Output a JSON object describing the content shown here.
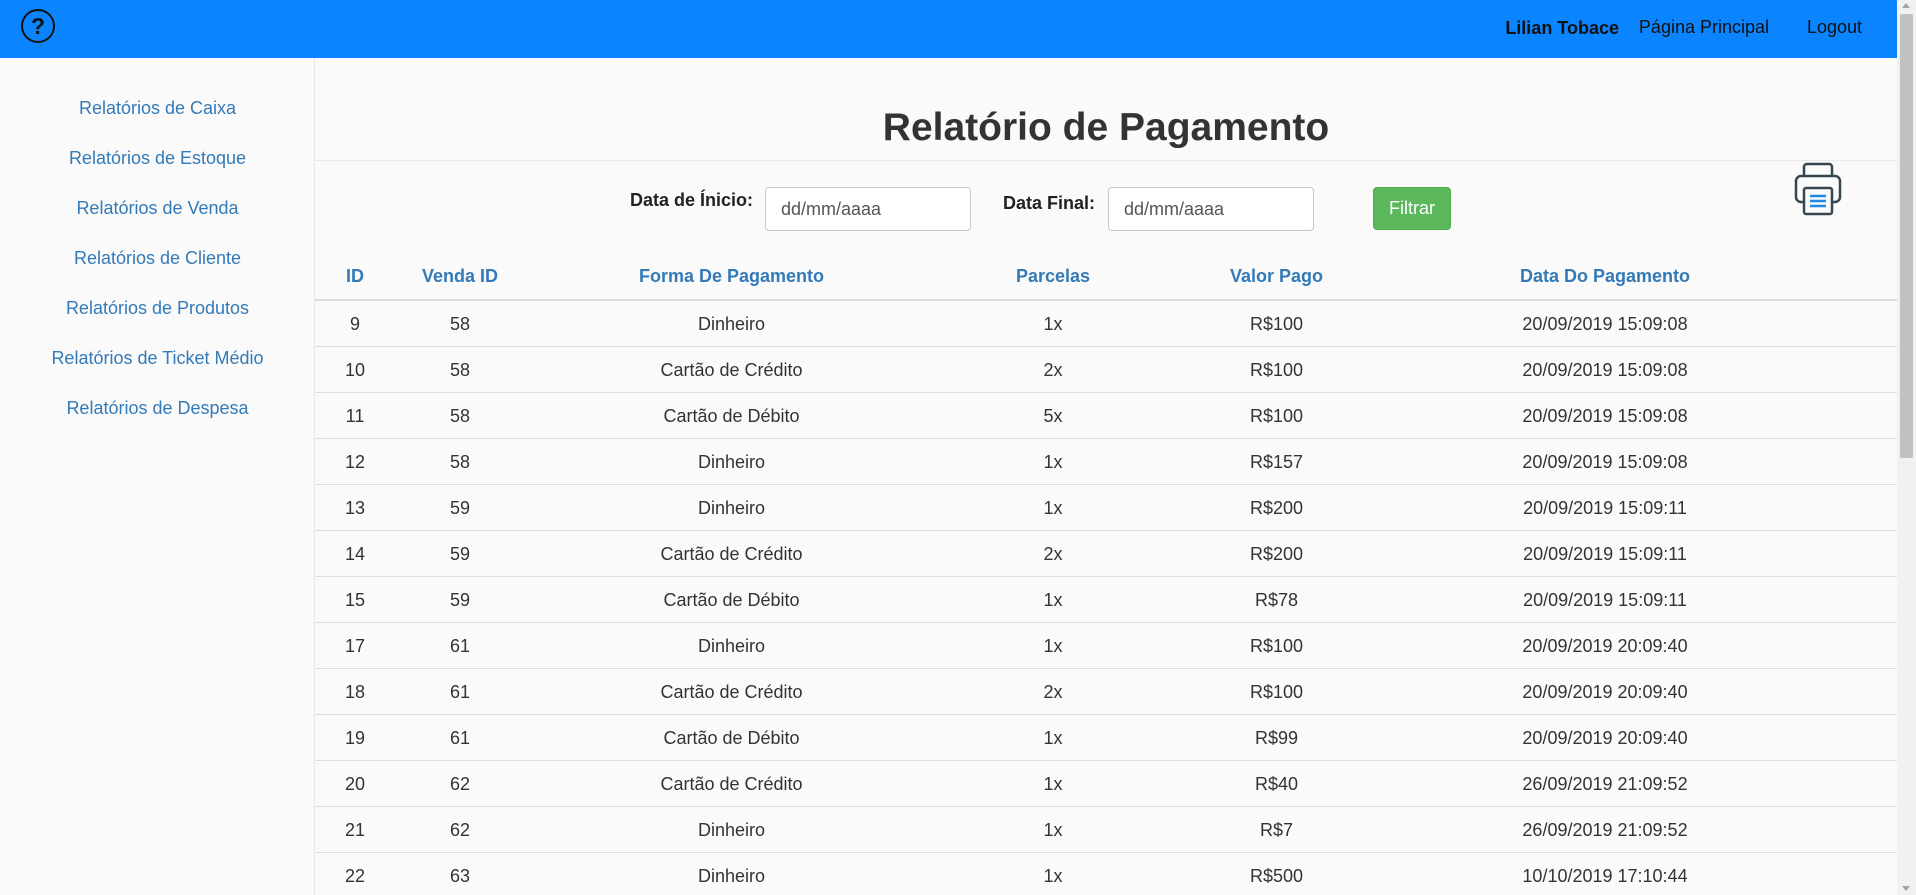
{
  "header": {
    "help_icon": "question-mark-circle-icon",
    "help_glyph": "?",
    "user_name": "Lilian Tobace",
    "home_link": "Página Principal",
    "logout_link": "Logout"
  },
  "sidebar": {
    "items": [
      {
        "label": "Relatórios de Caixa"
      },
      {
        "label": "Relatórios de Estoque"
      },
      {
        "label": "Relatórios de Venda"
      },
      {
        "label": "Relatórios de Cliente"
      },
      {
        "label": "Relatórios de Produtos"
      },
      {
        "label": "Relatórios de Ticket Médio"
      },
      {
        "label": "Relatórios de Despesa"
      }
    ]
  },
  "main": {
    "title": "Relatório de Pagamento",
    "filters": {
      "start_label": "Data de Ínicio:",
      "start_value": "dd/mm/aaaa",
      "end_label": "Data Final:",
      "end_value": "dd/mm/aaaa",
      "filter_button": "Filtrar"
    },
    "print_icon": "printer-icon",
    "table": {
      "headers": [
        "ID",
        "Venda ID",
        "Forma De Pagamento",
        "Parcelas",
        "Valor Pago",
        "Data Do Pagamento"
      ],
      "rows": [
        [
          "9",
          "58",
          "Dinheiro",
          "1x",
          "R$100",
          "20/09/2019 15:09:08"
        ],
        [
          "10",
          "58",
          "Cartão de Crédito",
          "2x",
          "R$100",
          "20/09/2019 15:09:08"
        ],
        [
          "11",
          "58",
          "Cartão de Débito",
          "5x",
          "R$100",
          "20/09/2019 15:09:08"
        ],
        [
          "12",
          "58",
          "Dinheiro",
          "1x",
          "R$157",
          "20/09/2019 15:09:08"
        ],
        [
          "13",
          "59",
          "Dinheiro",
          "1x",
          "R$200",
          "20/09/2019 15:09:11"
        ],
        [
          "14",
          "59",
          "Cartão de Crédito",
          "2x",
          "R$200",
          "20/09/2019 15:09:11"
        ],
        [
          "15",
          "59",
          "Cartão de Débito",
          "1x",
          "R$78",
          "20/09/2019 15:09:11"
        ],
        [
          "17",
          "61",
          "Dinheiro",
          "1x",
          "R$100",
          "20/09/2019 20:09:40"
        ],
        [
          "18",
          "61",
          "Cartão de Crédito",
          "2x",
          "R$100",
          "20/09/2019 20:09:40"
        ],
        [
          "19",
          "61",
          "Cartão de Débito",
          "1x",
          "R$99",
          "20/09/2019 20:09:40"
        ],
        [
          "20",
          "62",
          "Cartão de Crédito",
          "1x",
          "R$40",
          "26/09/2019 21:09:52"
        ],
        [
          "21",
          "62",
          "Dinheiro",
          "1x",
          "R$7",
          "26/09/2019 21:09:52"
        ],
        [
          "22",
          "63",
          "Dinheiro",
          "1x",
          "R$500",
          "10/10/2019 17:10:44"
        ]
      ]
    }
  },
  "colors": {
    "topbar": "#0a84ff",
    "link": "#337ab7",
    "filter_button": "#5cb85c"
  }
}
